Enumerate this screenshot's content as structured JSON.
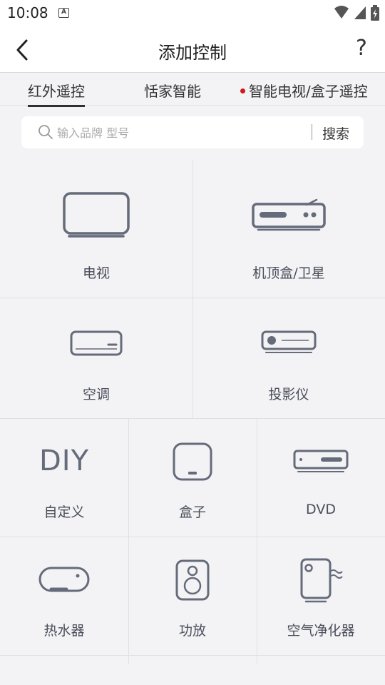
{
  "status_bar": {
    "time": "10:08",
    "notification": "A"
  },
  "header": {
    "title": "添加控制",
    "help": "?"
  },
  "tabs": [
    {
      "label": "红外遥控",
      "active": true
    },
    {
      "label": "恬家智能",
      "active": false
    },
    {
      "label": "智能电视/盒子遥控",
      "active": false,
      "dot": true
    }
  ],
  "search": {
    "placeholder": "输入品牌 型号",
    "value": "",
    "button": "搜索"
  },
  "devices_row1": [
    {
      "label": "电视",
      "icon": "tv-icon"
    },
    {
      "label": "机顶盒/卫星",
      "icon": "set-top-box-icon"
    }
  ],
  "devices_row2": [
    {
      "label": "空调",
      "icon": "air-conditioner-icon"
    },
    {
      "label": "投影仪",
      "icon": "projector-icon"
    }
  ],
  "devices_row3": [
    {
      "label": "自定义",
      "icon": "diy-icon",
      "icon_text": "DIY"
    },
    {
      "label": "盒子",
      "icon": "box-icon"
    },
    {
      "label": "DVD",
      "icon": "dvd-icon"
    }
  ],
  "devices_row4": [
    {
      "label": "热水器",
      "icon": "water-heater-icon"
    },
    {
      "label": "功放",
      "icon": "speaker-icon"
    },
    {
      "label": "空气净化器",
      "icon": "air-purifier-icon"
    }
  ],
  "colors": {
    "accent_dot": "#d01818",
    "icon_stroke": "#656b7a",
    "background": "#f3f3f5"
  }
}
